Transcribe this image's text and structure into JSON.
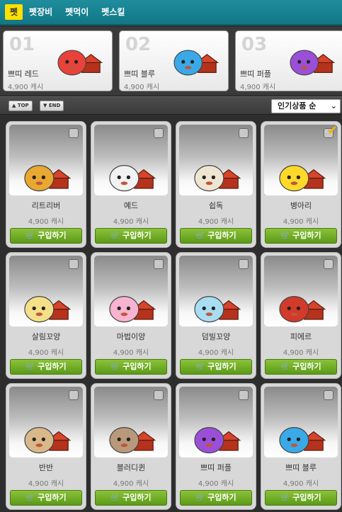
{
  "tabs": [
    {
      "label": "펫",
      "active": true
    },
    {
      "label": "펫장비",
      "active": false
    },
    {
      "label": "펫먹이",
      "active": false
    },
    {
      "label": "펫스킬",
      "active": false
    }
  ],
  "ranking": [
    {
      "num": "01",
      "name": "쁘띠 레드",
      "price": "4,900 캐시",
      "color": "#e8423a"
    },
    {
      "num": "02",
      "name": "쁘띠 블루",
      "price": "4,900 캐시",
      "color": "#3aa9e8"
    },
    {
      "num": "03",
      "name": "쁘띠 퍼플",
      "price": "4,900 캐시",
      "color": "#9b4fd8"
    }
  ],
  "toolbar": {
    "top_label": "TOP",
    "end_label": "END",
    "sort_value": "인기상품 순"
  },
  "buy_label": "구입하기",
  "products": [
    {
      "name": "리트리버",
      "price": "4,900 캐시",
      "checked": false,
      "pet_color": "#e8a832"
    },
    {
      "name": "예드",
      "price": "4,900 캐시",
      "checked": false,
      "pet_color": "#f2f2f2"
    },
    {
      "name": "쉽독",
      "price": "4,900 캐시",
      "checked": false,
      "pet_color": "#efe6d2"
    },
    {
      "name": "병아리",
      "price": "4,900 캐시",
      "checked": true,
      "pet_color": "#ffd92a"
    },
    {
      "name": "살림꼬양",
      "price": "4,900 캐시",
      "checked": false,
      "pet_color": "#f5e08a"
    },
    {
      "name": "마법이양",
      "price": "4,900 캐시",
      "checked": false,
      "pet_color": "#f7b3d0"
    },
    {
      "name": "덤빌꼬양",
      "price": "4,900 캐시",
      "checked": false,
      "pet_color": "#a9ddf2"
    },
    {
      "name": "피에르",
      "price": "4,900 캐시",
      "checked": false,
      "pet_color": "#d23a2a"
    },
    {
      "name": "반반",
      "price": "4,900 캐시",
      "checked": false,
      "pet_color": "#d9b88a"
    },
    {
      "name": "블러디퀸",
      "price": "4,900 캐시",
      "checked": false,
      "pet_color": "#b89a7a"
    },
    {
      "name": "쁘띠 퍼플",
      "price": "4,900 캐시",
      "checked": false,
      "pet_color": "#9b4fd8"
    },
    {
      "name": "쁘띠 블루",
      "price": "4,900 캐시",
      "checked": false,
      "pet_color": "#3aa9e8"
    }
  ]
}
